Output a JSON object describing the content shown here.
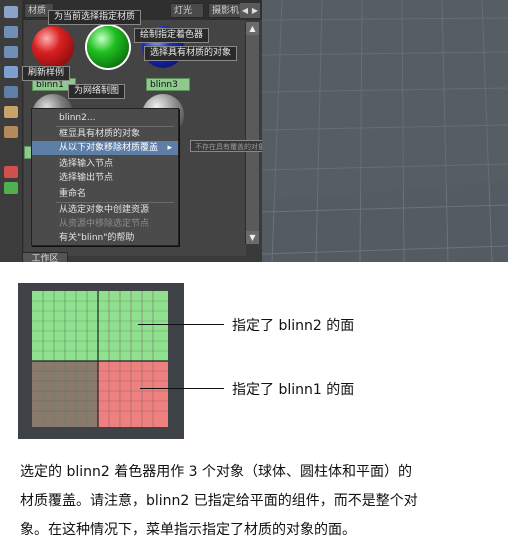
{
  "toolbar": {
    "tabs": [
      "材质",
      "灯光",
      "摄影机"
    ],
    "arrow_left": "◀",
    "arrow_right": "▶"
  },
  "tooltips": {
    "assign_to_selection": "为当前选择指定材质",
    "graph_shader": "绘制指定着色器",
    "select_objects": "选择具有材质的对象",
    "refresh_swatch": "刷新样例",
    "graph_network": "为网络制图"
  },
  "materials": [
    {
      "name": "blinn1",
      "color": "#d92020"
    },
    {
      "name": "blinn2",
      "color": "#1fbf1f"
    },
    {
      "name": "blinn3",
      "color": "#1a2ec9"
    }
  ],
  "context_menu": {
    "items": [
      {
        "label": "blinn2...",
        "state": "normal"
      },
      {
        "label": "框显具有材质的对象",
        "state": "normal"
      },
      {
        "label": "从以下对象移除材质覆盖",
        "state": "highlight",
        "has_submenu": true
      },
      {
        "label": "选择输入节点",
        "state": "normal"
      },
      {
        "label": "选择输出节点",
        "state": "normal"
      },
      {
        "label": "重命名",
        "state": "normal"
      },
      {
        "label": "从选定对象中创建资源",
        "state": "normal"
      },
      {
        "label": "从资源中移除选定节点",
        "state": "disabled"
      },
      {
        "label": "有关\"blinn\"的帮助",
        "state": "normal"
      }
    ],
    "submenu_text": "不存在具有覆盖的对象",
    "submenu_arrow": "▸"
  },
  "scrollbar": {
    "up": "▲",
    "down": "▼"
  },
  "workarea_tab": "工作区",
  "figure": {
    "annotations": [
      {
        "text": "指定了  blinn2  的面",
        "color_hint": "#7fe07f"
      },
      {
        "text": "指定了  blinn1  的面",
        "color_hint": "#e87a7a"
      }
    ]
  },
  "caption": {
    "lines": [
      "选定的 blinn2  着色器用作 3 个对象（球体、圆柱体和平面）的",
      "材质覆盖。请注意，blinn2 已指定给平面的组件，而不是整个对",
      "象。在这种情况下，菜单指示指定了材质的对象的面。"
    ]
  }
}
